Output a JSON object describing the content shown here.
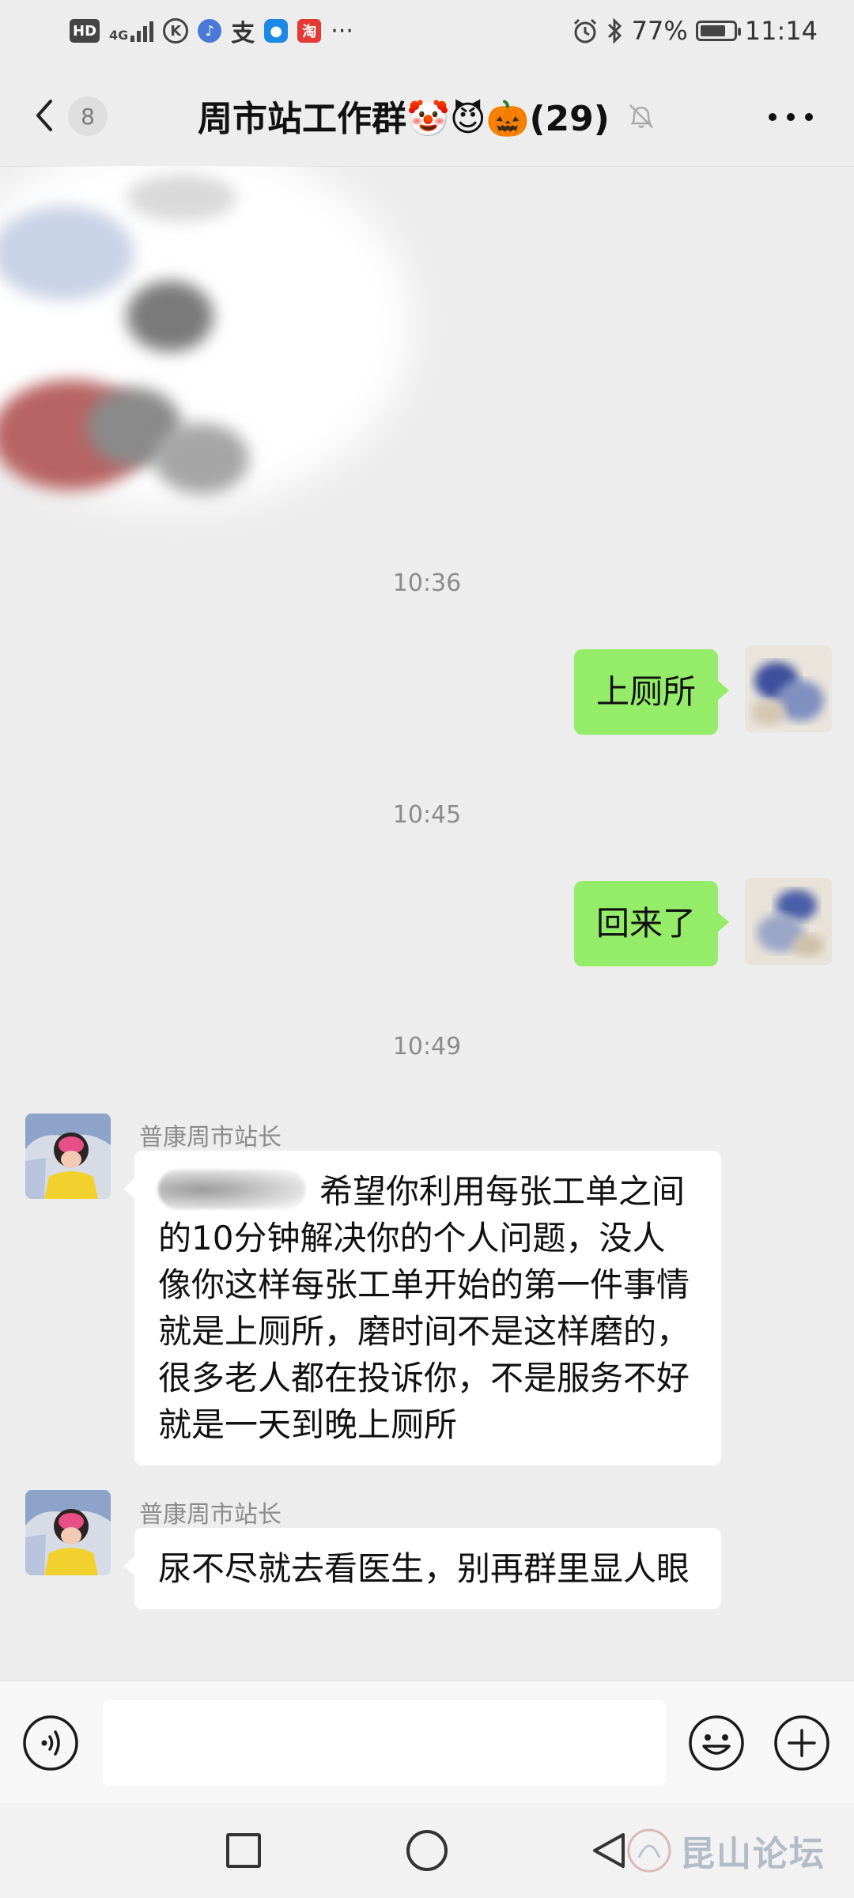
{
  "status_bar": {
    "left_badges": [
      "HD",
      "4G"
    ],
    "app_icons": [
      "k-icon",
      "music-icon",
      "alipay-icon",
      "bulb-icon",
      "taobao-icon"
    ],
    "alipay_glyph": "支",
    "taobao_glyph": "淘",
    "k_glyph": "K",
    "more_glyph": "···",
    "battery_percent": "77%",
    "battery_level": 0.77,
    "time": "11:14"
  },
  "header": {
    "unread_count": "8",
    "title": "周市站工作群🤡😈🎃(29)"
  },
  "messages": [
    {
      "type": "time",
      "text": "10:36"
    },
    {
      "type": "outgoing",
      "text": "上厕所"
    },
    {
      "type": "time",
      "text": "10:45"
    },
    {
      "type": "outgoing",
      "text": "回来了"
    },
    {
      "type": "time",
      "text": "10:49"
    },
    {
      "type": "incoming",
      "sender": "普康周市站长",
      "text": "希望你利用每张工单之间的10分钟解决你的个人问题，没人像你这样每张工单开始的第一件事情就是上厕所，磨时间不是这样磨的，很多老人都在投诉你，不是服务不好就是一天到晚上厕所"
    },
    {
      "type": "incoming",
      "sender": "普康周市站长",
      "text": "尿不尽就去看医生，别再群里显人眼"
    }
  ],
  "input": {
    "value": "",
    "placeholder": ""
  },
  "watermark": {
    "text": "昆山论坛"
  },
  "colors": {
    "outgoing_bubble": "#95ec69",
    "incoming_bubble": "#ffffff",
    "chat_background": "#ededed"
  }
}
